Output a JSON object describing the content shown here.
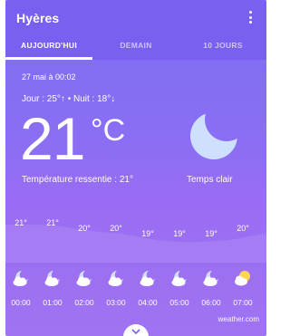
{
  "location": "Hyères",
  "tabs": [
    {
      "label": "AUJOURD'HUI",
      "active": true
    },
    {
      "label": "DEMAIN",
      "active": false
    },
    {
      "label": "10 JOURS",
      "active": false
    }
  ],
  "current": {
    "datetime": "27 mai à 00:02",
    "hilo": "Jour : 25°↑ • Nuit : 18°↓",
    "temperature": "21",
    "unit": "°C",
    "feels_like": "Température ressentie : 21°",
    "condition": "Temps clair",
    "condition_icon": "moon-icon"
  },
  "hourly": [
    {
      "time": "00:00",
      "temp": "21°",
      "icon": "moon-cloud-icon"
    },
    {
      "time": "01:00",
      "temp": "21°",
      "icon": "moon-cloud-icon"
    },
    {
      "time": "02:00",
      "temp": "20°",
      "icon": "moon-cloud-icon"
    },
    {
      "time": "03:00",
      "temp": "20°",
      "icon": "moon-cloud-icon"
    },
    {
      "time": "04:00",
      "temp": "19°",
      "icon": "moon-cloud-icon"
    },
    {
      "time": "05:00",
      "temp": "19°",
      "icon": "moon-cloud-icon"
    },
    {
      "time": "06:00",
      "temp": "19°",
      "icon": "moon-cloud-icon"
    },
    {
      "time": "07:00",
      "temp": "20°",
      "icon": "sun-cloud-icon"
    }
  ],
  "source": "weather.com",
  "colors": {
    "app_bar": "#7a5ff0",
    "moon": "#cfe0ff",
    "sun": "#ffd54f"
  }
}
